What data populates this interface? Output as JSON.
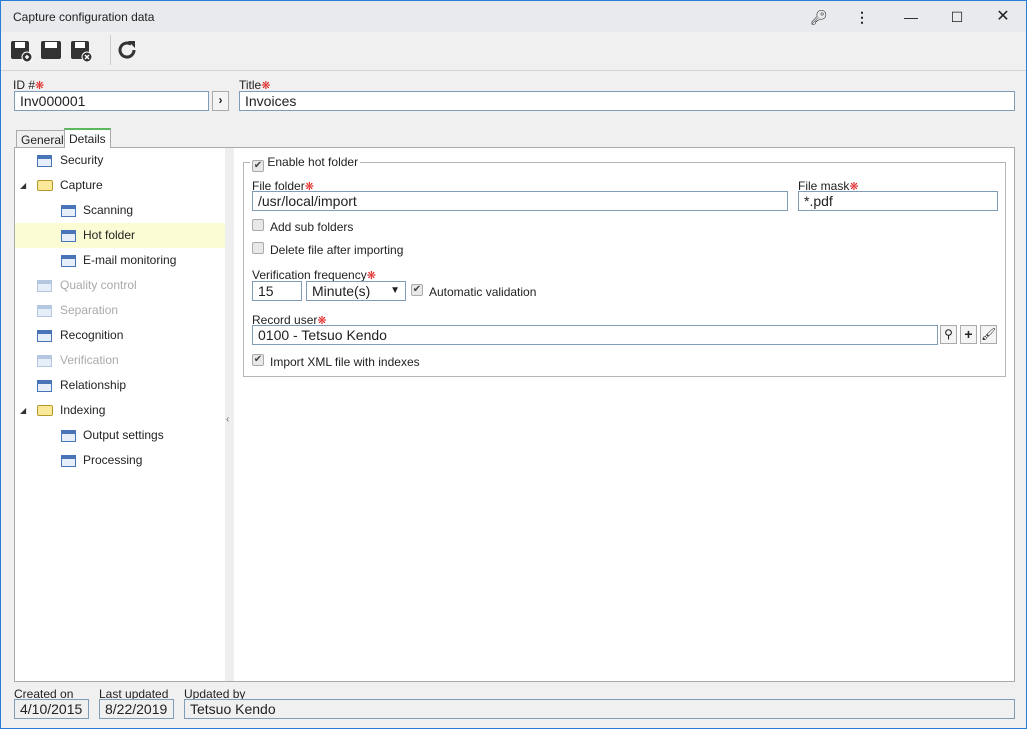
{
  "window": {
    "title": "Capture configuration data",
    "icons": [
      "key-icon",
      "more-vert-icon",
      "minimize-icon",
      "maximize-icon",
      "close-icon"
    ]
  },
  "toolbar": {
    "buttons": [
      "save-new-icon",
      "save-icon",
      "save-close-icon",
      "refresh-icon"
    ]
  },
  "header": {
    "id_label": "ID #",
    "id_value": "Inv000001",
    "title_label": "Title",
    "title_value": "Invoices"
  },
  "tabs": [
    {
      "label": "General"
    },
    {
      "label": "Details",
      "active": true
    }
  ],
  "tree": [
    {
      "label": "Security",
      "level": 0,
      "type": "item"
    },
    {
      "label": "Capture",
      "level": 0,
      "type": "folder",
      "expanded": true
    },
    {
      "label": "Scanning",
      "level": 1,
      "type": "item"
    },
    {
      "label": "Hot folder",
      "level": 1,
      "type": "item",
      "selected": true
    },
    {
      "label": "E-mail monitoring",
      "level": 1,
      "type": "item"
    },
    {
      "label": "Quality control",
      "level": 0,
      "type": "item",
      "disabled": true
    },
    {
      "label": "Separation",
      "level": 0,
      "type": "item",
      "disabled": true
    },
    {
      "label": "Recognition",
      "level": 0,
      "type": "item"
    },
    {
      "label": "Verification",
      "level": 0,
      "type": "item",
      "disabled": true
    },
    {
      "label": "Relationship",
      "level": 0,
      "type": "item"
    },
    {
      "label": "Indexing",
      "level": 0,
      "type": "folder",
      "expanded": true
    },
    {
      "label": "Output settings",
      "level": 1,
      "type": "item"
    },
    {
      "label": "Processing",
      "level": 1,
      "type": "item"
    }
  ],
  "form": {
    "enable_hot_folder": {
      "label": "Enable hot folder",
      "checked": true
    },
    "file_folder_label": "File folder",
    "file_folder": "/usr/local/import",
    "file_mask_label": "File mask",
    "file_mask": "*.pdf",
    "add_sub_folders": {
      "label": "Add sub folders",
      "checked": false
    },
    "delete_after": {
      "label": "Delete file after importing",
      "checked": false
    },
    "freq_label": "Verification frequency",
    "freq_value": "15",
    "freq_unit": "Minute(s)",
    "auto_validation": {
      "label": "Automatic validation",
      "checked": true
    },
    "record_user_label": "Record user",
    "record_user": "0100 - Tetsuo Kendo",
    "import_xml": {
      "label": "Import XML file with indexes",
      "checked": true
    }
  },
  "footer": {
    "created_label": "Created on",
    "created": "4/10/2015",
    "updated_label": "Last updated",
    "updated": "8/22/2019",
    "by_label": "Updated by",
    "by": "Tetsuo Kendo"
  },
  "required_mark": "❋",
  "check_mark": "✔"
}
